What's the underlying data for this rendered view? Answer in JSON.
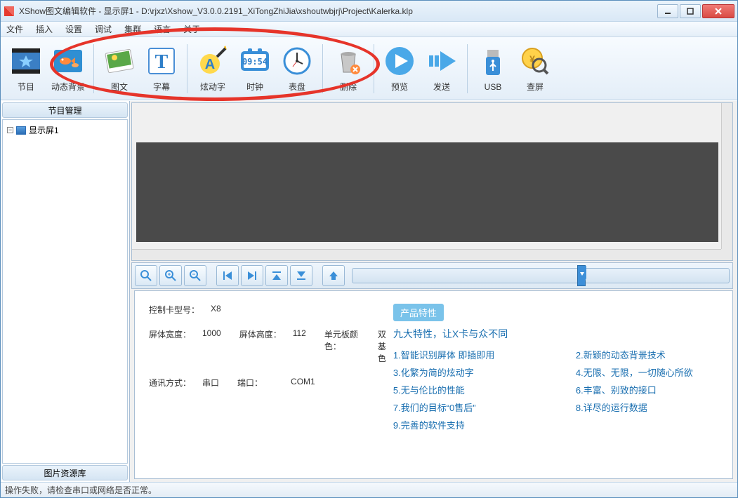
{
  "titlebar": {
    "title": "XShow图文编辑软件 - 显示屏1 - D:\\rjxz\\Xshow_V3.0.0.2191_XiTongZhiJia\\xshoutwbjrj\\Project\\Kalerka.klp"
  },
  "menu": [
    "文件",
    "插入",
    "设置",
    "调试",
    "集群",
    "语言",
    "关于"
  ],
  "toolbar": {
    "items": [
      {
        "label": "节目"
      },
      {
        "label": "动态背景"
      },
      {
        "label": "图文"
      },
      {
        "label": "字幕"
      },
      {
        "label": "炫动字"
      },
      {
        "label": "时钟",
        "clock": "09:54"
      },
      {
        "label": "表盘"
      },
      {
        "label": "删除"
      },
      {
        "label": "预览"
      },
      {
        "label": "发送"
      },
      {
        "label": "USB"
      },
      {
        "label": "查屏"
      }
    ]
  },
  "sidebar": {
    "header": "节目管理",
    "tree_item": "显示屏1",
    "asset_btn": "图片资源库"
  },
  "info": {
    "card_model_k": "控制卡型号：",
    "card_model_v": "X8",
    "width_k": "屏体宽度：",
    "width_v": "1000",
    "height_k": "屏体高度：",
    "height_v": "112",
    "cellcolor_k": "单元板颜色：",
    "cellcolor_v": "双基色",
    "comm_k": "通讯方式：",
    "comm_v": "串口",
    "port_k": "端口：",
    "port_v": "COM1"
  },
  "features": {
    "tag": "产品特性",
    "subtitle": "九大特性，让X卡与众不同",
    "list": [
      "1.智能识别屏体 即插即用",
      "2.新颖的动态背景技术",
      "3.化繁为简的炫动字",
      "4.无限、无限，一切随心所欲",
      "5.无与伦比的性能",
      "6.丰富、别致的接口",
      "7.我们的目标“0售后”",
      "8.详尽的运行数据",
      "9.完善的软件支持"
    ]
  },
  "status": "操作失败，请检查串口或网络是否正常。"
}
